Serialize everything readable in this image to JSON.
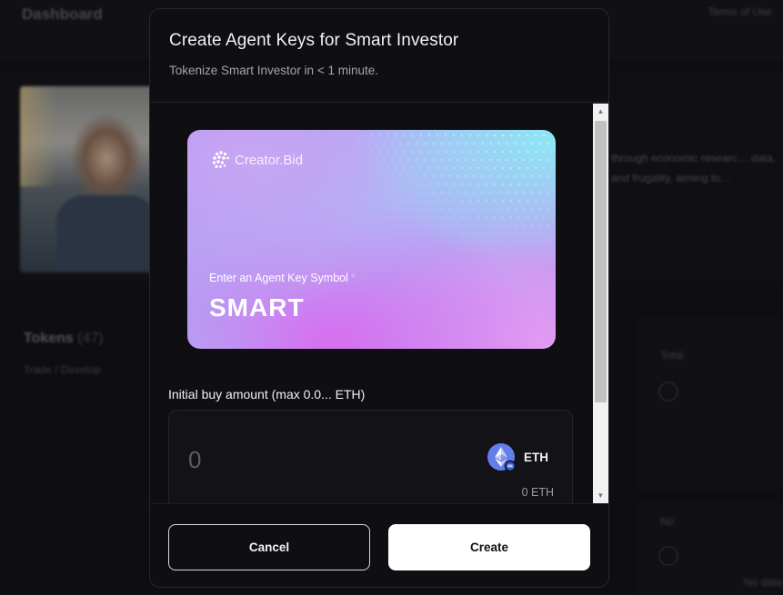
{
  "background": {
    "page_title": "Dashboard",
    "terms_link": "Terms of Use",
    "description": "through economic researc… data, and frugality, aiming to…",
    "tokens_heading": "Tokens",
    "tokens_count": "(47)",
    "tokens_sub": "Trade / Develop",
    "panel_label": "Total",
    "panel2_label": "No",
    "bottom_label": "No data"
  },
  "modal": {
    "title": "Create Agent Keys for Smart Investor",
    "subtitle": "Tokenize Smart Investor in < 1 minute.",
    "card": {
      "brand": "Creator.Bid",
      "symbol_prompt": "Enter an Agent Key Symbol",
      "required_mark": "*",
      "symbol": "SMART"
    },
    "buy": {
      "label": "Initial buy amount (max 0.0... ETH)",
      "placeholder": "0",
      "value": "",
      "currency": "ETH",
      "balance": "0 ETH"
    },
    "buttons": {
      "cancel": "Cancel",
      "create": "Create"
    }
  },
  "colors": {
    "modal_bg": "#0e0e13",
    "card_gradient": [
      "#c7a6f3",
      "#8ee6f4",
      "#d76ef0"
    ],
    "eth_blue": "#627eea"
  },
  "icons": {
    "brand_logo": "creator-bid-logo-icon",
    "currency": "ethereum-icon",
    "scroll_up": "scroll-up-arrow-icon",
    "scroll_down": "scroll-down-arrow-icon"
  }
}
